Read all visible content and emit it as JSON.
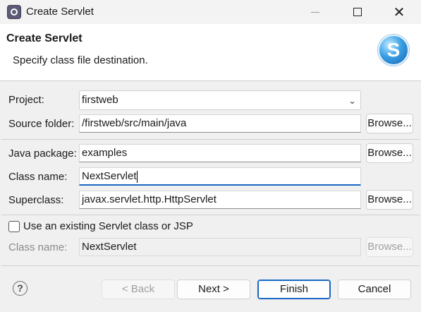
{
  "window": {
    "title": "Create Servlet",
    "minimize": "—",
    "maximize": "☐",
    "close": "✕"
  },
  "banner": {
    "title": "Create Servlet",
    "description": "Specify class file destination.",
    "logo_letter": "S"
  },
  "form": {
    "project": {
      "label": "Project:",
      "value": "firstweb"
    },
    "source_folder": {
      "label": "Source folder:",
      "value": "/firstweb/src/main/java",
      "browse": "Browse..."
    },
    "java_package": {
      "label": "Java package:",
      "value": "examples",
      "browse": "Browse..."
    },
    "class_name": {
      "label": "Class name:",
      "value": "NextServlet"
    },
    "superclass": {
      "label": "Superclass:",
      "value": "javax.servlet.http.HttpServlet",
      "browse": "Browse..."
    },
    "use_existing": {
      "label": "Use an existing Servlet class or JSP",
      "checked": false
    },
    "existing_class_name": {
      "label": "Class name:",
      "value": "NextServlet",
      "browse": "Browse..."
    }
  },
  "footer": {
    "help": "?",
    "back": "< Back",
    "next": "Next >",
    "finish": "Finish",
    "cancel": "Cancel"
  },
  "colors": {
    "accent": "#1967c5",
    "banner_bg": "#ffffff",
    "dialog_bg": "#f0f0f0"
  },
  "icons": {
    "app": "eclipse-icon",
    "dropdown": "chevron-down-icon",
    "logo": "servlet-logo-icon",
    "help": "help-icon"
  }
}
